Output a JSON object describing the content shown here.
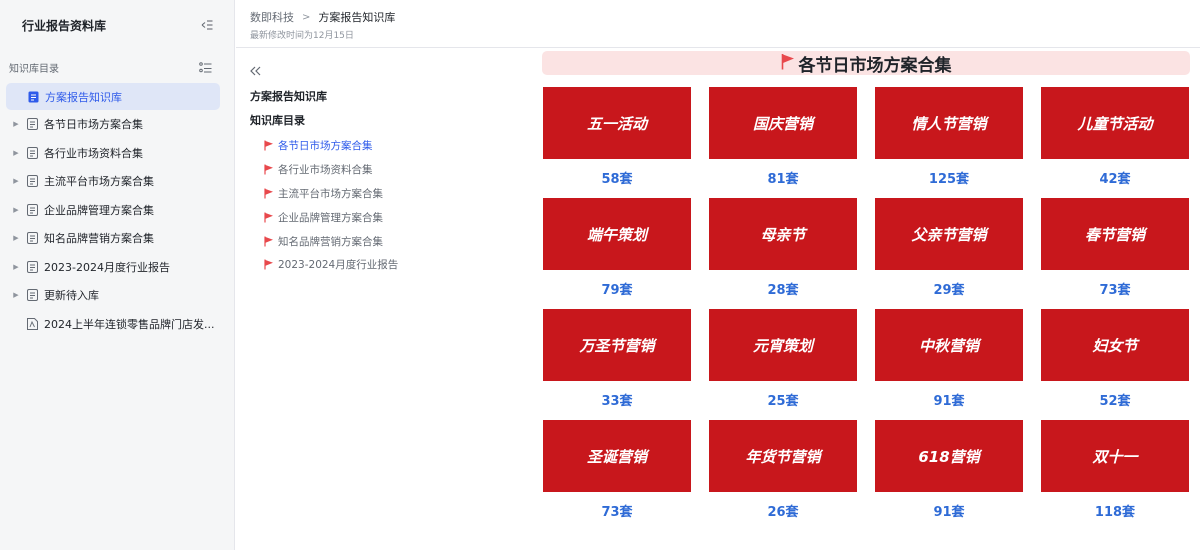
{
  "sidebar": {
    "title": "行业报告资料库",
    "section_label": "知识库目录",
    "items": [
      {
        "label": "方案报告知识库",
        "active": true,
        "arrow": false
      },
      {
        "label": "各节日市场方案合集",
        "arrow": true
      },
      {
        "label": "各行业市场资料合集",
        "arrow": true
      },
      {
        "label": "主流平台市场方案合集",
        "arrow": true
      },
      {
        "label": "企业品牌管理方案合集",
        "arrow": true
      },
      {
        "label": "知名品牌营销方案合集",
        "arrow": true
      },
      {
        "label": "2023-2024月度行业报告",
        "arrow": true
      },
      {
        "label": "更新待入库",
        "arrow": true
      },
      {
        "label": "2024上半年连锁零售品牌门店发...",
        "arrow": false,
        "pdf": true
      }
    ]
  },
  "header": {
    "crumb_root": "数即科技",
    "crumb_current": "方案报告知识库",
    "modified": "最新修改时间为12月15日"
  },
  "outline": {
    "title": "方案报告知识库",
    "subtitle": "知识库目录",
    "items": [
      {
        "label": "各节日市场方案合集",
        "active": true
      },
      {
        "label": "各行业市场资料合集"
      },
      {
        "label": "主流平台市场方案合集"
      },
      {
        "label": "企业品牌管理方案合集"
      },
      {
        "label": "知名品牌营销方案合集"
      },
      {
        "label": "2023-2024月度行业报告"
      }
    ]
  },
  "main": {
    "banner": "各节日市场方案合集",
    "tiles": [
      {
        "label": "五一活动",
        "count": "58套"
      },
      {
        "label": "国庆营销",
        "count": "81套"
      },
      {
        "label": "情人节营销",
        "count": "125套"
      },
      {
        "label": "儿童节活动",
        "count": "42套"
      },
      {
        "label": "端午策划",
        "count": "79套"
      },
      {
        "label": "母亲节",
        "count": "28套"
      },
      {
        "label": "父亲节营销",
        "count": "29套"
      },
      {
        "label": "春节营销",
        "count": "73套"
      },
      {
        "label": "万圣节营销",
        "count": "33套"
      },
      {
        "label": "元宵策划",
        "count": "25套"
      },
      {
        "label": "中秋营销",
        "count": "91套"
      },
      {
        "label": "妇女节",
        "count": "52套"
      },
      {
        "label": "圣诞营销",
        "count": "73套"
      },
      {
        "label": "年货节营销",
        "count": "26套"
      },
      {
        "label": "618营销",
        "count": "91套"
      },
      {
        "label": "双十一",
        "count": "118套"
      }
    ]
  },
  "colors": {
    "accent": "#2f5bea",
    "tile": "#c8171c",
    "count": "#2f6bd6",
    "banner_bg": "#fbe3e3"
  }
}
